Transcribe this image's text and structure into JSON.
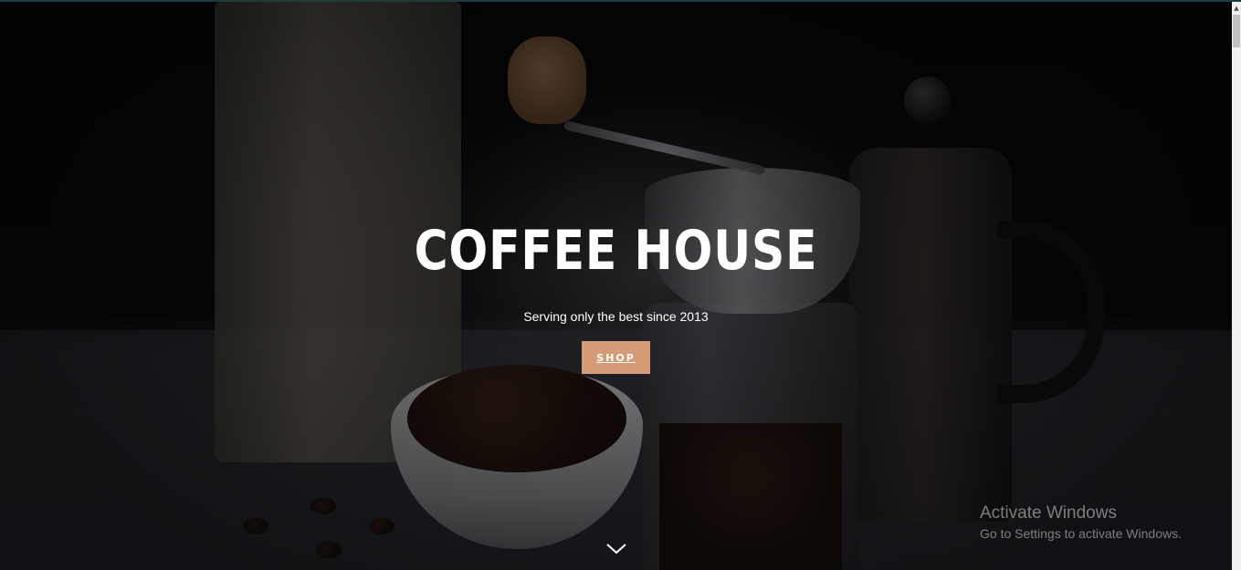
{
  "hero": {
    "title": "COFFEE HOUSE",
    "subtitle": "Serving only the best since 2013",
    "shop_label": "SHOP",
    "accent_color": "#d59b76",
    "scroll_icon": "chevron-down-icon"
  },
  "watermark": {
    "title": "Activate Windows",
    "subtitle": "Go to Settings to activate Windows."
  },
  "scrollbar": {
    "up_arrow": "▲"
  }
}
